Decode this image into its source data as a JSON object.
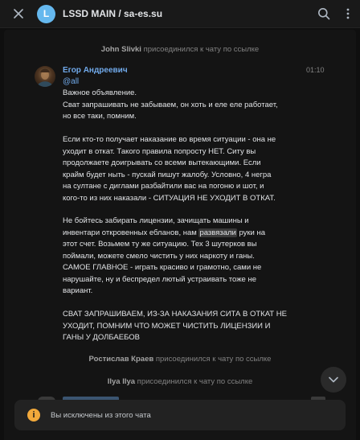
{
  "header": {
    "avatar_letter": "L",
    "title": "LSSD MAIN / sa-es.su",
    "avatar_color": "#65b8ee"
  },
  "service_top": {
    "name": "John Slivki",
    "action": " присоединился к чату по ссылке"
  },
  "message": {
    "sender": "Егор Андреевич",
    "time": "01:10",
    "mention": "@all",
    "p1": "Важное объявление.\nСват запрашивать не забываем, он хоть и  еле еле работает,\nно все таки, помним.",
    "p2": "Если кто-то получает наказание во время ситуации - она не\nуходит в откат. Такого правила попросту НЕТ. Ситу вы\nпродолжаете доигрывать со всеми вытекающими. Если\nкрайм будет ныть - пускай пишут жалобу. Условно, 4 негра\nна султане с диглами разбайтили вас на погоню и шот, и\nкого-то из них наказали - СИТУАЦИЯ НЕ УХОДИТ В ОТКАТ.",
    "p3_before": "Не бойтесь забирать лицензии, зачищать машины и\nинвентари откровенных ебланов, нам ",
    "p3_highlight": "развязали",
    "p3_after": " руки на\nэтот счет. Возьмем ту же ситуацию. Тех 3 шутерков вы\nпоймали, можете смело чистить у них наркоту и ганы.\nСАМОЕ ГЛАВНОЕ - играть красиво и грамотно, сами не\nнарушайте, ну и беспредел лютый устраивать тоже не\nвариант.",
    "p4": "СВАТ ЗАПРАШИВАЕМ, ИЗ-ЗА НАКАЗАНИЯ СИТА В ОТКАТ НЕ\nУХОДИТ, ПОМНИМ ЧТО МОЖЕТ ЧИСТИТЬ ЛИЦЕНЗИИ И\nГАНЫ У ДОЛБАЕБОВ"
  },
  "service_1": {
    "name": "Ростислав Краев",
    "action": " присоединился к чату по ссылке"
  },
  "service_2": {
    "name": "Ilya Ilya",
    "action": " присоединился к чату по ссылке"
  },
  "notice": {
    "icon_text": "i",
    "text": "Вы исключены из этого чата",
    "icon_color": "#f2a93b"
  },
  "icons": [
    "close-icon",
    "search-icon",
    "more-icon",
    "chevron-down-icon",
    "info-icon"
  ],
  "colors": {
    "accent": "#71aaeb",
    "background": "#141414",
    "warning": "#f2a93b"
  }
}
